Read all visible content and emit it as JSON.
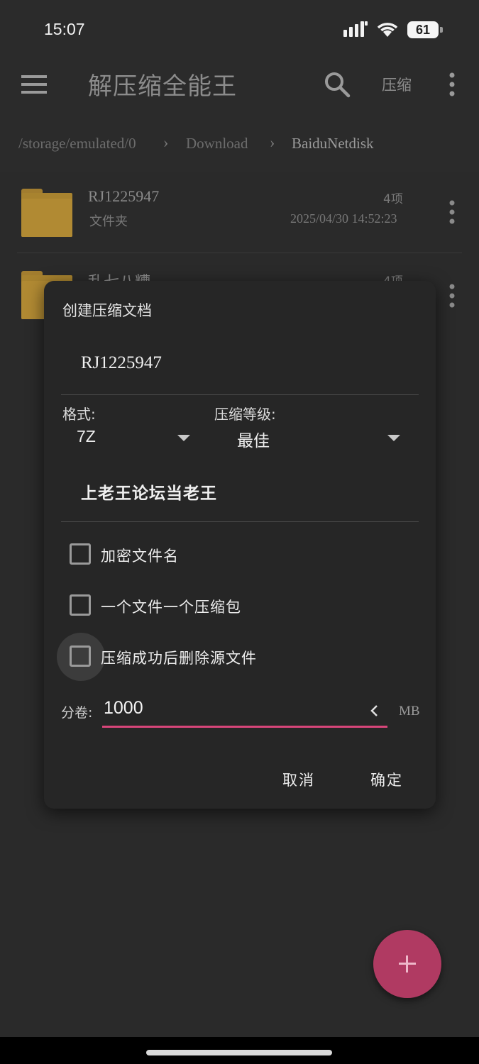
{
  "status_bar": {
    "time": "15:07",
    "battery": "61"
  },
  "toolbar": {
    "title": "解压缩全能王",
    "compress_label": "压缩"
  },
  "breadcrumb": [
    "/storage/emulated/0",
    "Download",
    "BaiduNetdisk"
  ],
  "files": [
    {
      "name": "RJ1225947",
      "type": "文件夹",
      "count": "4项",
      "date": "2025/04/30 14:52:23"
    },
    {
      "name": "乱七八糟",
      "count": "4项"
    }
  ],
  "dialog": {
    "title": "创建压缩文档",
    "archive_name": "RJ1225947",
    "format_label": "格式:",
    "format_value": "7Z",
    "level_label": "压缩等级:",
    "level_value": "最佳",
    "password": "上老王论坛当老王",
    "options": [
      {
        "label": "加密文件名",
        "checked": false
      },
      {
        "label": "一个文件一个压缩包",
        "checked": false
      },
      {
        "label": "压缩成功后删除源文件",
        "checked": false
      }
    ],
    "split_label": "分卷:",
    "split_value": "1000",
    "split_unit": "MB",
    "cancel_label": "取消",
    "ok_label": "确定"
  },
  "colors": {
    "accent": "#d8467a",
    "fab": "#b03a62",
    "folder": "#b18a33"
  },
  "icons": [
    "menu-icon",
    "search-icon",
    "more-vert-icon",
    "folder-icon",
    "chevron-right-icon",
    "dropdown-arrow-icon",
    "chevron-left-icon",
    "plus-icon",
    "signal-icon",
    "wifi-icon",
    "battery-icon"
  ]
}
